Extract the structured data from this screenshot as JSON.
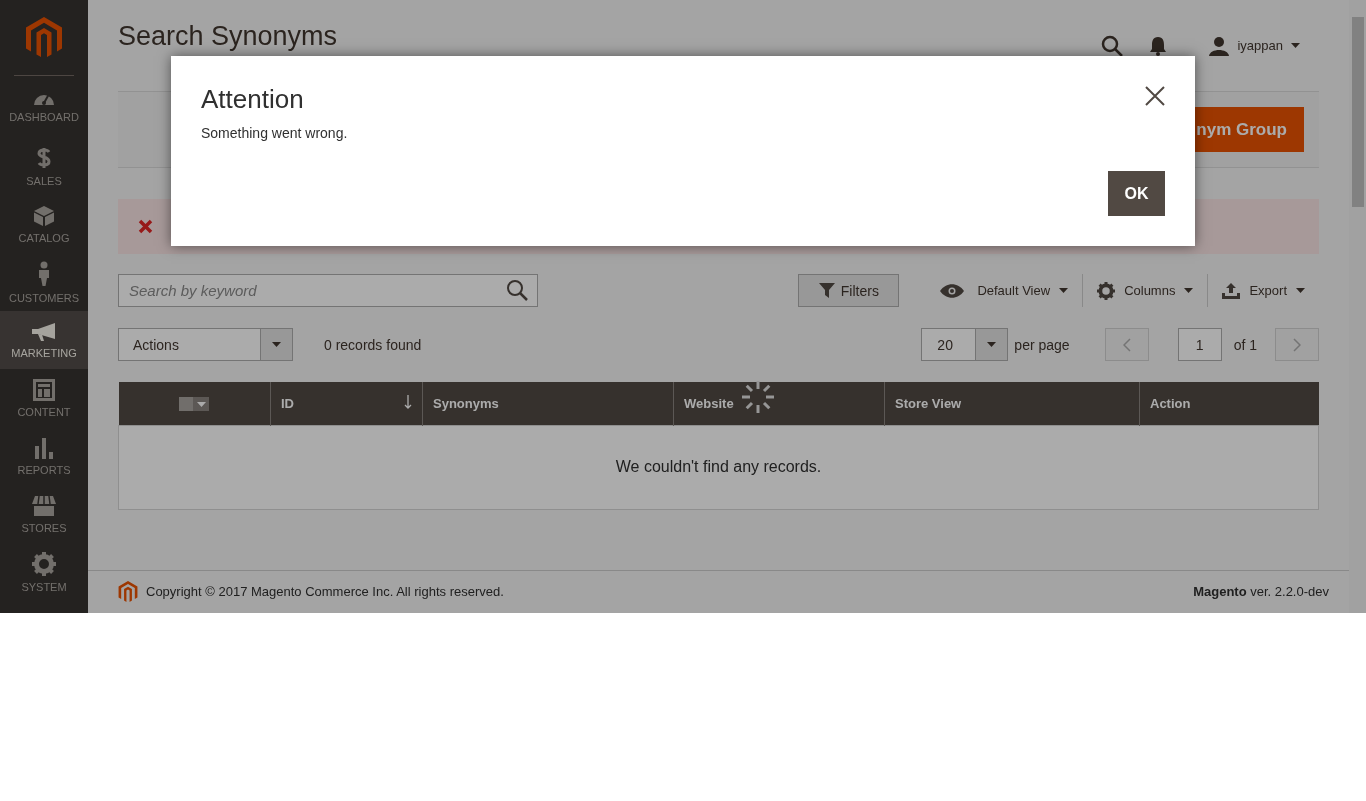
{
  "sidebar": {
    "items": [
      {
        "label": "DASHBOARD",
        "selected": false
      },
      {
        "label": "SALES",
        "selected": false
      },
      {
        "label": "CATALOG",
        "selected": false
      },
      {
        "label": "CUSTOMERS",
        "selected": false
      },
      {
        "label": "MARKETING",
        "selected": true
      },
      {
        "label": "CONTENT",
        "selected": false
      },
      {
        "label": "REPORTS",
        "selected": false
      },
      {
        "label": "STORES",
        "selected": false
      },
      {
        "label": "SYSTEM",
        "selected": false
      }
    ]
  },
  "header": {
    "title": "Search Synonyms",
    "user": "iyappan"
  },
  "action_bar": {
    "button": "nym Group"
  },
  "grid": {
    "search": {
      "placeholder": "Search by keyword"
    },
    "filters": "Filters",
    "view": "Default View",
    "columns_menu": "Columns",
    "export": "Export",
    "actions": "Actions",
    "records": "0 records found",
    "page_size": "20",
    "per_page": "per page",
    "page": "1",
    "page_total": "of 1",
    "table": {
      "columns": [
        {
          "sorted": false
        },
        {
          "label": "ID",
          "sorted": true
        },
        {
          "label": "Synonyms",
          "sorted": false
        },
        {
          "label": "Website",
          "sorted": false
        },
        {
          "label": "Store View",
          "sorted": false
        },
        {
          "label": "Action",
          "sorted": false
        }
      ],
      "empty_message": "We couldn't find any records."
    }
  },
  "footer": {
    "copyright": "Copyright © 2017 Magento Commerce Inc. All rights reserved.",
    "version": "**Magento** ver. 2.2.0-dev"
  },
  "dialog": {
    "title": "Attention",
    "message": "Something went wrong.",
    "ok": "OK"
  }
}
